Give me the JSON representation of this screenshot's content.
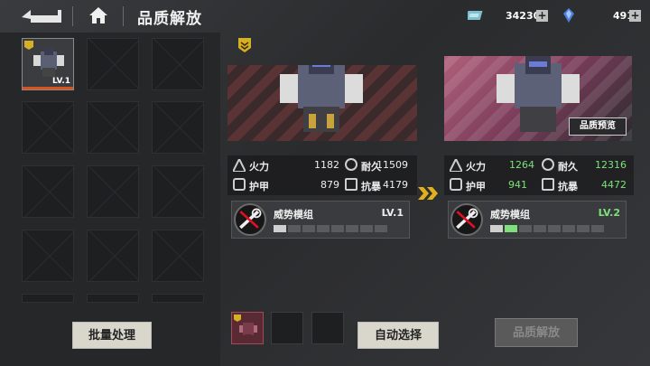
{
  "header": {
    "title": "品质解放",
    "currency1": "342303",
    "currency2": "491",
    "plus": "+"
  },
  "inventory": {
    "selected_level": "LV.1"
  },
  "left_button": "批量处理",
  "current": {
    "stats": [
      {
        "label": "火力",
        "value": "1182"
      },
      {
        "label": "耐久",
        "value": "11509"
      },
      {
        "label": "护甲",
        "value": "879"
      },
      {
        "label": "抗暴",
        "value": "4179"
      }
    ],
    "module_name": "威势模组",
    "module_level": "LV.1"
  },
  "preview": {
    "label": "品质预览",
    "stats": [
      {
        "label": "火力",
        "value": "1264"
      },
      {
        "label": "耐久",
        "value": "12316"
      },
      {
        "label": "护甲",
        "value": "941"
      },
      {
        "label": "抗暴",
        "value": "4472"
      }
    ],
    "module_name": "威势模组",
    "module_level": "LV.2"
  },
  "auto_button": "自动选择",
  "release_button": "品质解放",
  "colors": {
    "accent_orange": "#d9531e",
    "upgrade_green": "#7ee07a",
    "gold_badge": "#d6b024"
  }
}
